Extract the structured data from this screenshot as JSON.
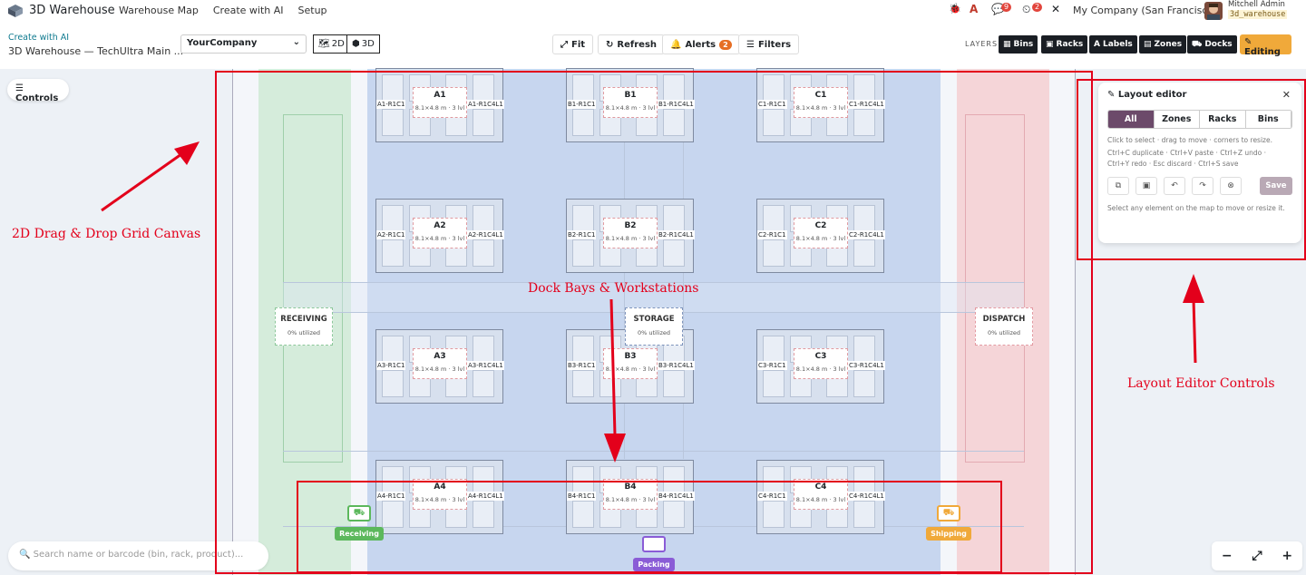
{
  "topbar": {
    "app_name": "3D Warehouse",
    "menu": [
      "Warehouse Map",
      "Create with AI",
      "Setup"
    ],
    "chat_badge": "9",
    "activity_badge": "2",
    "company": "My Company (San Francisco)",
    "user_name": "Mitchell Admin",
    "db_name": "3d_warehouse"
  },
  "breadcrumb": {
    "parent": "Create with AI",
    "current": "3D Warehouse — TechUltra Main ..."
  },
  "toolbar": {
    "company_select": "YourCompany",
    "view_2d": "2D",
    "view_3d": "3D",
    "fit": "Fit",
    "refresh": "Refresh",
    "alerts": "Alerts",
    "alerts_count": "2",
    "filters": "Filters",
    "layers_label": "LAYERS",
    "layers": [
      "Bins",
      "Racks",
      "Labels",
      "Zones",
      "Docks"
    ],
    "editing": "Editing"
  },
  "canvas": {
    "controls": "Controls",
    "search_placeholder": "Search name or barcode (bin, rack, product)...",
    "zoom_out": "−",
    "zoom_fit": "⤢",
    "zoom_in": "+"
  },
  "racks": [
    {
      "name": "A1",
      "dim": "8.1×4.8 m · 3 lvl",
      "left_bin": "A1-R1C1",
      "right_bin": "A1-R1C4L1"
    },
    {
      "name": "B1",
      "dim": "8.1×4.8 m · 3 lvl",
      "left_bin": "B1-R1C1",
      "right_bin": "B1-R1C4L1"
    },
    {
      "name": "C1",
      "dim": "8.1×4.8 m · 3 lvl",
      "left_bin": "C1-R1C1",
      "right_bin": "C1-R1C4L1"
    },
    {
      "name": "A2",
      "dim": "8.1×4.8 m · 3 lvl",
      "left_bin": "A2-R1C1",
      "right_bin": "A2-R1C4L1"
    },
    {
      "name": "B2",
      "dim": "8.1×4.8 m · 3 lvl",
      "left_bin": "B2-R1C1",
      "right_bin": "B2-R1C4L1"
    },
    {
      "name": "C2",
      "dim": "8.1×4.8 m · 3 lvl",
      "left_bin": "C2-R1C1",
      "right_bin": "C2-R1C4L1"
    },
    {
      "name": "A3",
      "dim": "8.1×4.8 m · 3 lvl",
      "left_bin": "A3-R1C1",
      "right_bin": "A3-R1C4L1"
    },
    {
      "name": "B3",
      "dim": "8.1×4.8 m · 3 lvl",
      "left_bin": "B3-R1C1",
      "right_bin": "B3-R1C4L1"
    },
    {
      "name": "C3",
      "dim": "8.1×4.8 m · 3 lvl",
      "left_bin": "C3-R1C1",
      "right_bin": "C3-R1C4L1"
    },
    {
      "name": "A4",
      "dim": "8.1×4.8 m · 3 lvl",
      "left_bin": "A4-R1C1",
      "right_bin": "A4-R1C4L1"
    },
    {
      "name": "B4",
      "dim": "8.1×4.8 m · 3 lvl",
      "left_bin": "B4-R1C1",
      "right_bin": "B4-R1C4L1"
    },
    {
      "name": "C4",
      "dim": "8.1×4.8 m · 3 lvl",
      "left_bin": "C4-R1C1",
      "right_bin": "C4-R1C4L1"
    }
  ],
  "zones": {
    "receiving": {
      "title": "RECEIVING",
      "util": "0% utilized"
    },
    "storage": {
      "title": "STORAGE",
      "util": "0% utilized"
    },
    "dispatch": {
      "title": "DISPATCH",
      "util": "0% utilized"
    }
  },
  "docks": {
    "receiving": "Receiving",
    "packing": "Packing",
    "shipping": "Shipping"
  },
  "layout_editor": {
    "title": "Layout editor",
    "tabs": [
      "All",
      "Zones",
      "Racks",
      "Bins"
    ],
    "hint1": "Click to select · drag to move · corners to resize.",
    "hint2": "Ctrl+C duplicate · Ctrl+V paste · Ctrl+Z undo · Ctrl+Y redo · Esc discard · Ctrl+S save",
    "save": "Save",
    "hint3": "Select any element on the map to move or resize it."
  },
  "annotations": {
    "canvas": "2D Drag & Drop Grid Canvas",
    "docks": "Dock Bays & Workstations",
    "editor": "Layout Editor Controls"
  },
  "colors": {
    "accent_editing": "#f0a93a",
    "segment_active": "#6c4a6a",
    "annotation_red": "#e3001b",
    "receiving_zone": "#d5ecdb",
    "storage_zone": "#c7d6ef",
    "dispatch_zone": "#f5d5d8"
  }
}
